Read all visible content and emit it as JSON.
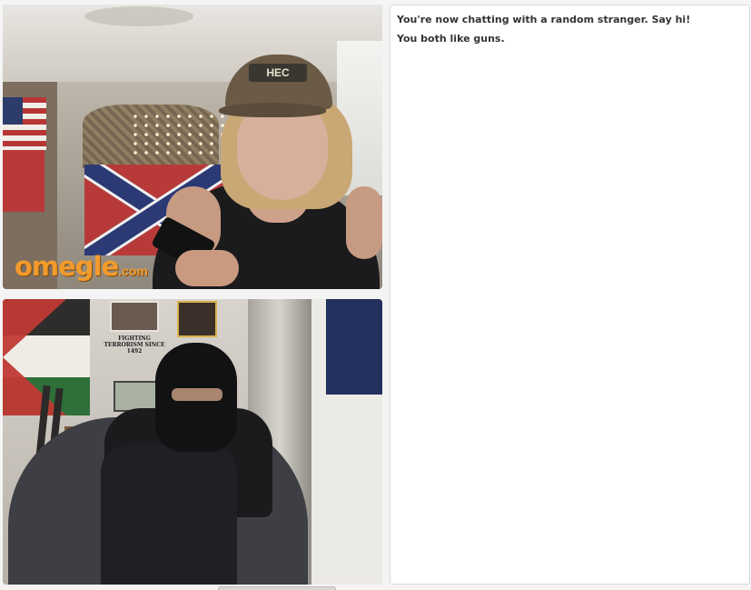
{
  "watermark": {
    "logo_word": "omegle",
    "logo_suffix": ".com"
  },
  "stranger_video": {
    "cap_text": "HEC"
  },
  "self_video": {
    "poster_text": "FIGHTING TERRORISM SINCE 1492"
  },
  "chat": {
    "messages": [
      "You're now chatting with a random stranger. Say hi!",
      "You both like guns."
    ]
  },
  "colors": {
    "logo_orange": "#f29b2c",
    "page_background": "#f4f4f4",
    "chat_background": "#ffffff"
  }
}
